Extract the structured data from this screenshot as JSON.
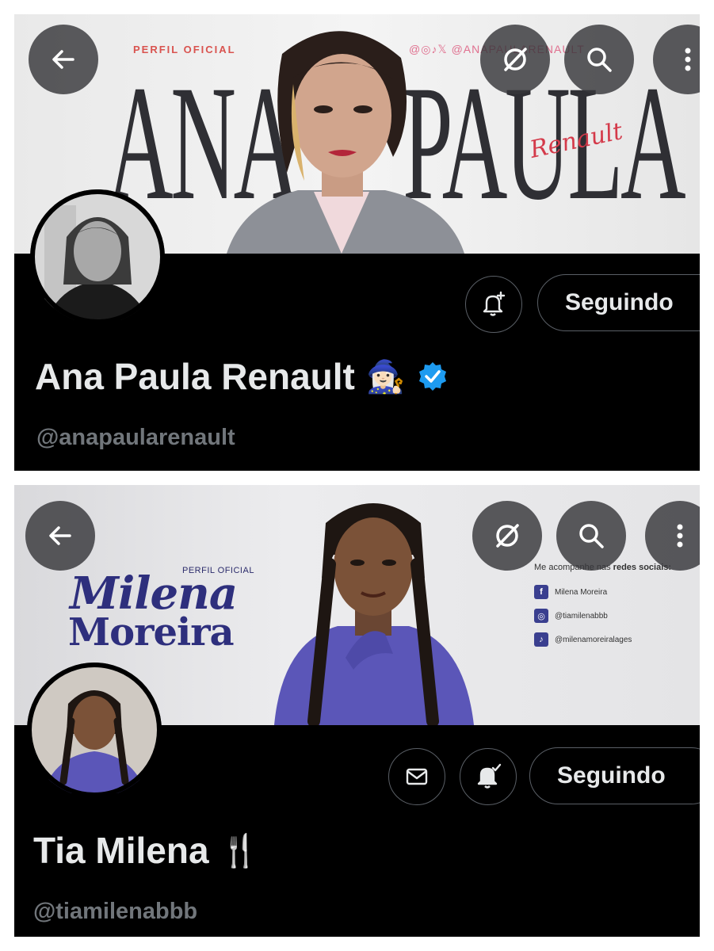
{
  "profiles": [
    {
      "banner": {
        "tag_prefix": "PERFIL ",
        "tag_bold": "OFICIAL",
        "social_handle": "@◎♪𝕏 @ANAPAULARENAULT",
        "first_name": "ANA",
        "last_name": "PAULA",
        "script_text": "Renault"
      },
      "display_name": "Ana Paula Renault",
      "name_emoji": "🧙🏻‍♀️",
      "verified": true,
      "handle": "@anapaularenault",
      "follow_label": "Seguindo",
      "colors": {
        "verified_badge": "#1d9bf0",
        "banner_accent": "#d43a4a"
      }
    },
    {
      "banner": {
        "tag": "PERFIL OFICIAL",
        "script_first": "Milena",
        "last_name": "Moreira",
        "side_title": "Me acompanhe nas ",
        "side_title_bold": "redes sociais:",
        "socials": [
          {
            "icon": "facebook-icon",
            "glyph": "f",
            "label": "Milena Moreira"
          },
          {
            "icon": "instagram-icon",
            "glyph": "◎",
            "label": "@tiamilenabbb"
          },
          {
            "icon": "tiktok-icon",
            "glyph": "♪",
            "label": "@milenamoreiralages"
          }
        ]
      },
      "display_name": "Tia Milena",
      "name_emoji": "🍴",
      "verified": false,
      "handle": "@tiamilenabbb",
      "follow_label": "Seguindo",
      "colors": {
        "banner_accent": "#2e2f7d"
      }
    }
  ]
}
